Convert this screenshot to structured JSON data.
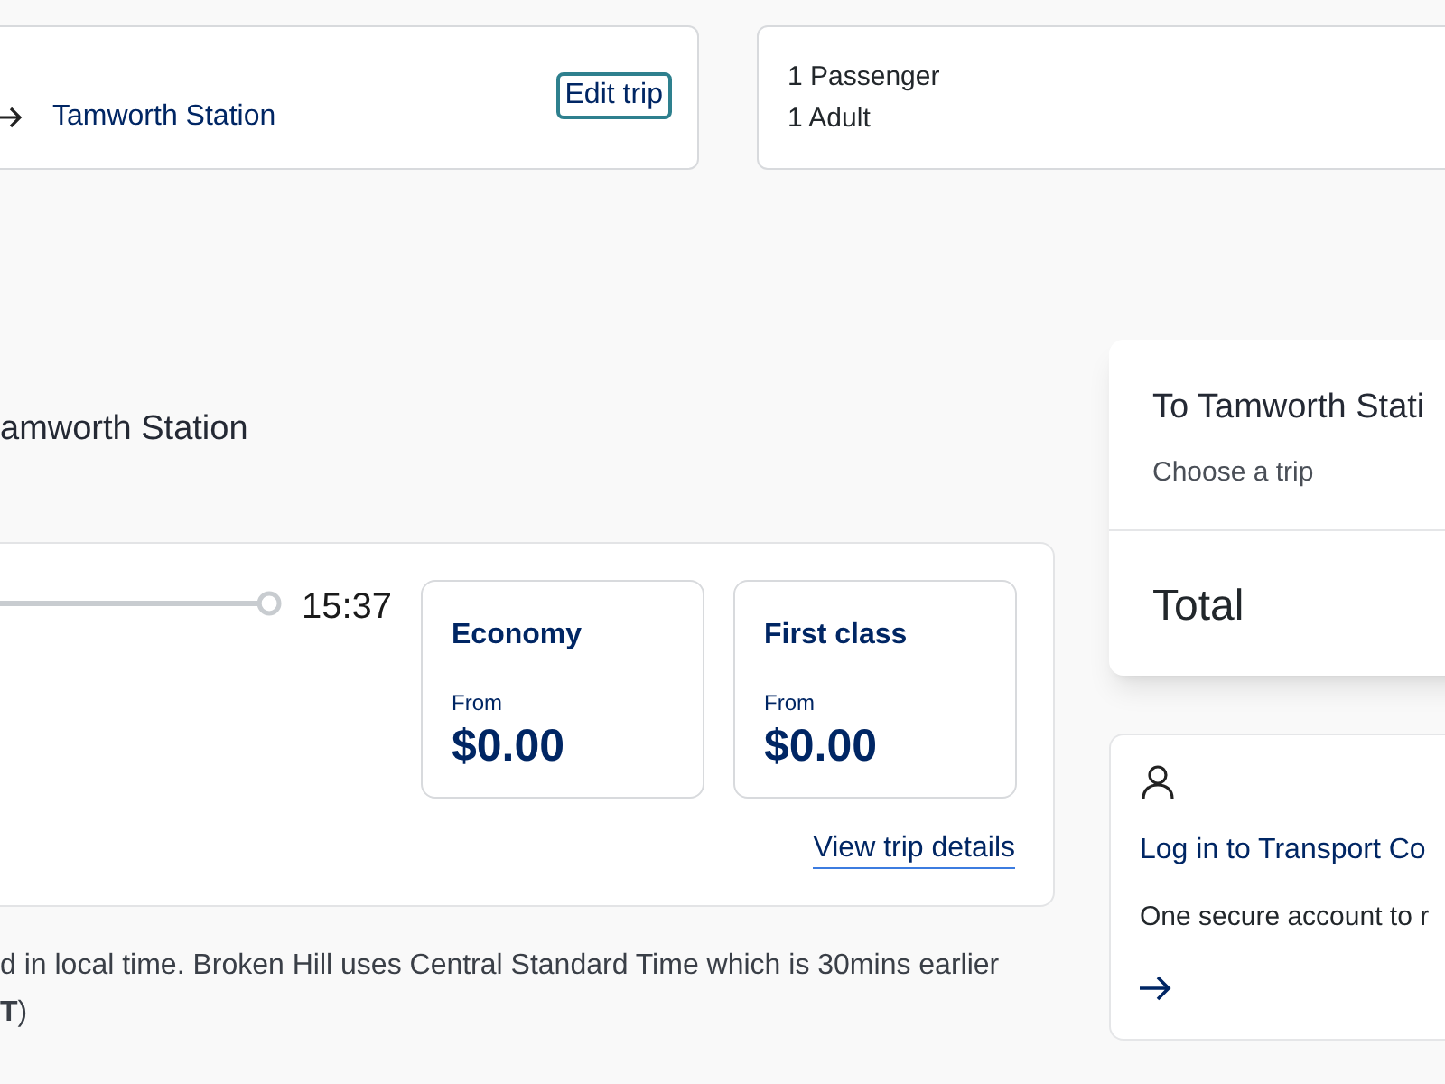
{
  "trip_summary": {
    "destination": "Tamworth Station",
    "edit_button": "Edit trip"
  },
  "passengers": {
    "count": "1 Passenger",
    "type": "1 Adult"
  },
  "section_heading": "amworth Station",
  "trip": {
    "arrival_time": "15:37",
    "fares": [
      {
        "name": "Economy",
        "from": "From",
        "price": "$0.00"
      },
      {
        "name": "First class",
        "from": "From",
        "price": "$0.00"
      }
    ],
    "details_link": "View trip details"
  },
  "note": [
    "d in local time. Broken Hill uses Central Standard Time which is 30mins earlier",
    "**T**)"
  ],
  "order_summary": {
    "title": "To Tamworth Stati",
    "subtitle": "Choose a trip",
    "total": "Total"
  },
  "login": {
    "link": "Log in to Transport Co",
    "text": "One secure account to r"
  }
}
